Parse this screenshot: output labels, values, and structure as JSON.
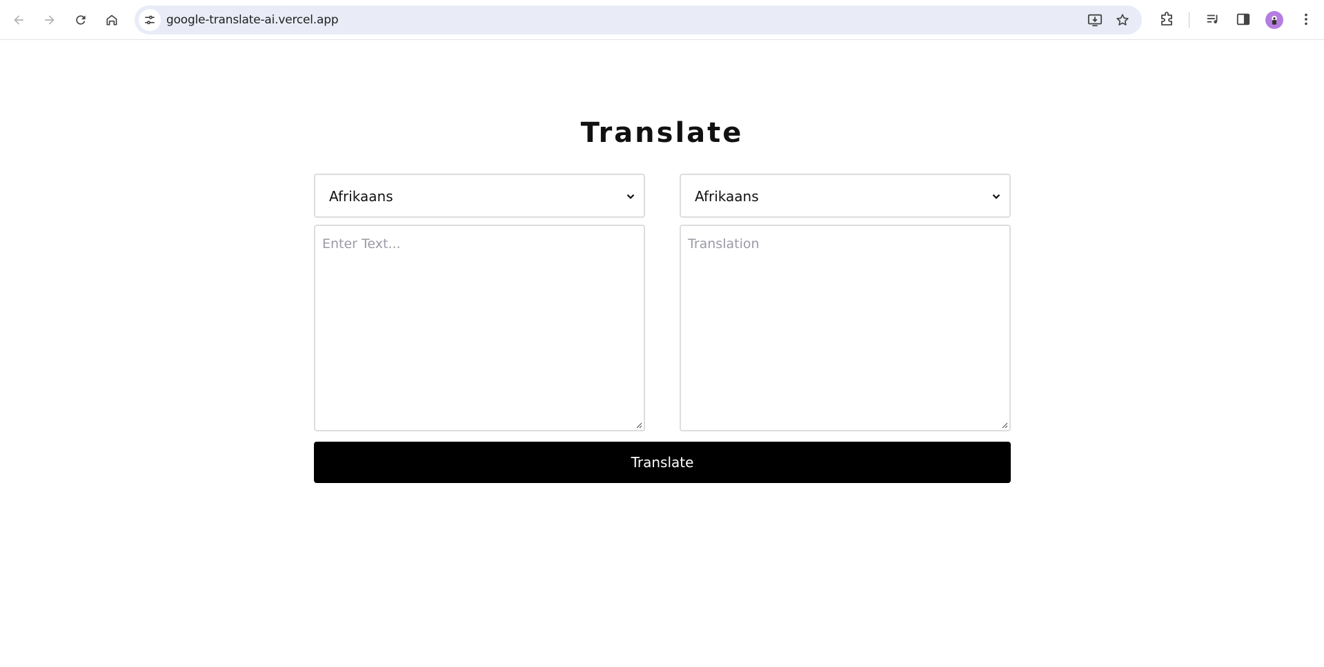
{
  "browser": {
    "url": "google-translate-ai.vercel.app"
  },
  "app": {
    "title": "Translate",
    "source_language": "Afrikaans",
    "target_language": "Afrikaans",
    "source_placeholder": "Enter Text...",
    "target_placeholder": "Translation",
    "translate_button_label": "Translate"
  },
  "icons": {
    "back": "back-arrow-icon",
    "forward": "forward-arrow-icon",
    "reload": "reload-icon",
    "home": "home-icon",
    "site_info": "tune-icon",
    "install": "install-app-icon",
    "bookmark": "star-icon",
    "extensions": "puzzle-icon",
    "media": "media-control-icon",
    "side_panel": "side-panel-icon",
    "profile": "avatar-icon",
    "menu": "kebab-menu-icon"
  },
  "colors": {
    "button_bg": "#000000",
    "omnibox_bg": "#e9ecf6",
    "avatar_bg": "#b57de0",
    "placeholder": "#9a9aa6"
  }
}
